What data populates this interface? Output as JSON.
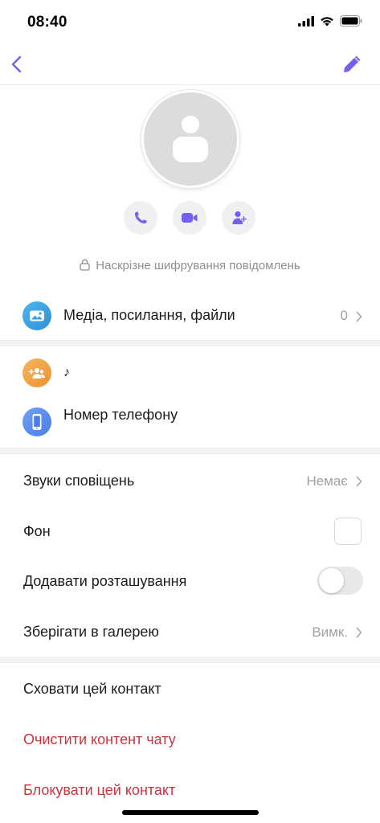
{
  "status_bar": {
    "time": "08:40"
  },
  "encryption_text": "Наскрізне шифрування повідомлень",
  "media": {
    "label": "Медіа, посилання, файли",
    "count": "0"
  },
  "info": {
    "name": "♪",
    "phone_label": "Номер телефону"
  },
  "settings": {
    "sounds_label": "Звуки сповіщень",
    "sounds_value": "Немає",
    "background_label": "Фон",
    "location_label": "Додавати розташування",
    "location_enabled": false,
    "gallery_label": "Зберігати в галерею",
    "gallery_value": "Вимк."
  },
  "actions": {
    "hide_contact": "Сховати цей контакт",
    "clear_chat": "Очистити контент чату",
    "block_contact": "Блокувати цей контакт"
  },
  "colors": {
    "accent": "#7360f2",
    "danger": "#d0323e",
    "media_icon": "#3a9ee0",
    "group_icon": "#f2a24a",
    "phone_icon": "#5b8ef0"
  },
  "icons": {
    "back": "chevron-left-icon",
    "edit": "pencil-icon",
    "call": "phone-icon",
    "video": "video-camera-icon",
    "add_participant": "add-person-icon",
    "lock": "lock-icon",
    "media": "gallery-icon",
    "group": "group-icon",
    "phone": "smartphone-icon",
    "chevron": "chevron-right-icon"
  }
}
